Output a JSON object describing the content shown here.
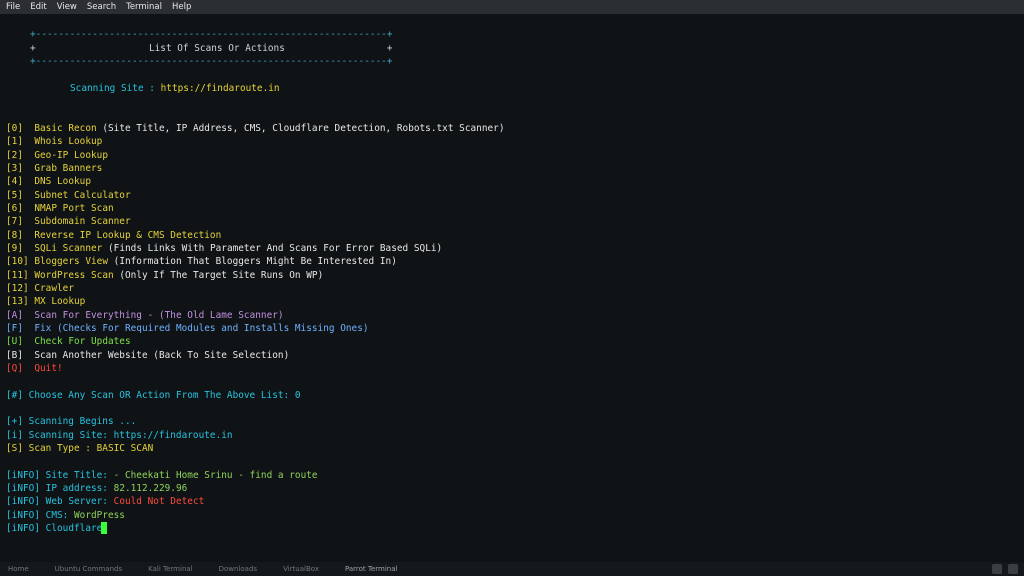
{
  "menubar": {
    "items": [
      "File",
      "Edit",
      "View",
      "Search",
      "Terminal",
      "Help"
    ]
  },
  "terminal": {
    "border_line": "+--------------------------------------------------------------+",
    "header_title": "+                    List Of Scans Or Actions                  +",
    "scanning_site_label": "Scanning Site : https://findaroute.in",
    "menu": [
      {
        "key": "[0]",
        "label": "Basic Recon",
        "desc": " (Site Title, IP Address, CMS, Cloudflare Detection, Robots.txt Scanner)"
      },
      {
        "key": "[1]",
        "label": "Whois Lookup",
        "desc": ""
      },
      {
        "key": "[2]",
        "label": "Geo-IP Lookup",
        "desc": ""
      },
      {
        "key": "[3]",
        "label": "Grab Banners",
        "desc": ""
      },
      {
        "key": "[4]",
        "label": "DNS Lookup",
        "desc": ""
      },
      {
        "key": "[5]",
        "label": "Subnet Calculator",
        "desc": ""
      },
      {
        "key": "[6]",
        "label": "NMAP Port Scan",
        "desc": ""
      },
      {
        "key": "[7]",
        "label": "Subdomain Scanner",
        "desc": ""
      },
      {
        "key": "[8]",
        "label": "Reverse IP Lookup & CMS Detection",
        "desc": ""
      },
      {
        "key": "[9]",
        "label": "SQLi Scanner",
        "desc": " (Finds Links With Parameter And Scans For Error Based SQLi)"
      },
      {
        "key": "[10]",
        "label": "Bloggers View",
        "desc": " (Information That Bloggers Might Be Interested In)"
      },
      {
        "key": "[11]",
        "label": "WordPress Scan",
        "desc": " (Only If The Target Site Runs On WP)"
      },
      {
        "key": "[12]",
        "label": "Crawler",
        "desc": ""
      },
      {
        "key": "[13]",
        "label": "MX Lookup",
        "desc": ""
      }
    ],
    "actions": [
      {
        "key": "[A]",
        "label": "Scan For Everything - (The Old Lame Scanner)"
      },
      {
        "key": "[F]",
        "label": "Fix (Checks For Required Modules and Installs Missing Ones)"
      },
      {
        "key": "[U]",
        "label": "Check For Updates"
      },
      {
        "key": "[B]",
        "label": "Scan Another Website (Back To Site Selection)"
      },
      {
        "key": "[Q]",
        "label": "Quit!"
      }
    ],
    "prompt": "[#] Choose Any Scan OR Action From The Above List: 0",
    "scan_begins": "[+] Scanning Begins ...",
    "scanning_site_info": "[i] Scanning Site: https://findaroute.in",
    "scan_type": "[S] Scan Type : BASIC SCAN",
    "info": {
      "tag": "[iNFO]",
      "site_title_label": " Site Title:",
      "site_title_value": " - Cheekati Home Srinu - find a route",
      "ip_label": " IP address:",
      "ip_value": " 82.112.229.96",
      "web_server_label": " Web Server:",
      "web_server_value": " Could Not Detect",
      "cms_label": " CMS:",
      "cms_value": " WordPress",
      "cloudflare_label": " Cloudflare:"
    }
  },
  "taskbar": {
    "items": [
      "Home",
      "Ubuntu Commands",
      "Kali Terminal",
      "Downloads",
      "VirtualBox",
      "Parrot Terminal"
    ]
  }
}
